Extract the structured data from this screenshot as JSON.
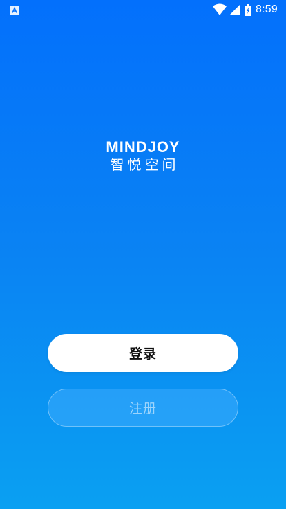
{
  "status_bar": {
    "time": "8:59",
    "notification_icon": "a-box-icon",
    "wifi_icon": "wifi-icon",
    "signal_icon": "signal-icon",
    "battery_icon": "battery-charging-icon"
  },
  "logo": {
    "title_en": "MINDJOY",
    "title_cn": "智悦空间"
  },
  "actions": {
    "login_label": "登录",
    "register_label": "注册"
  },
  "colors": {
    "background_top": "#0370fc",
    "background_bottom": "#0aa0f2",
    "login_button_bg": "#ffffff",
    "login_button_text": "#111111"
  }
}
